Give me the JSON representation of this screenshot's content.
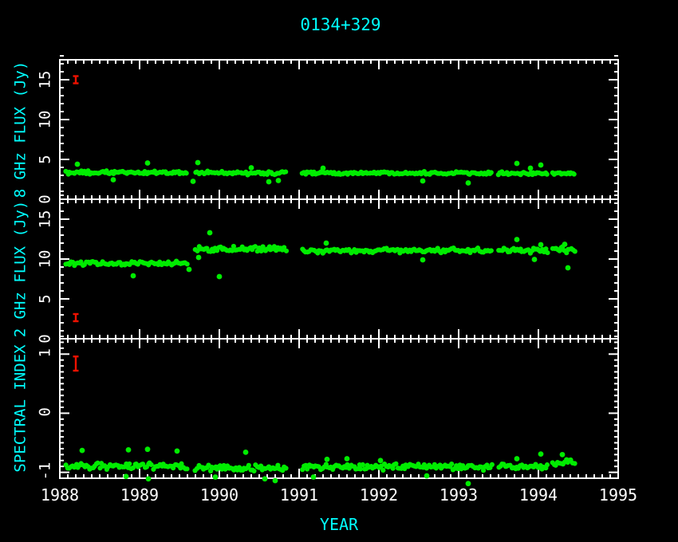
{
  "title": "0134+329",
  "xlabel": "YEAR",
  "colors": {
    "background": "#000000",
    "axis": "#ffffff",
    "tick_text": "#ffffff",
    "label": "#00ffff",
    "data": "#00ec00",
    "error": "#ee1100"
  },
  "x_axis": {
    "range": [
      1988,
      1995
    ],
    "tick_values": [
      1988,
      1989,
      1990,
      1991,
      1992,
      1993,
      1994,
      1995
    ],
    "tick_labels": [
      "1988",
      "1989",
      "1990",
      "1991",
      "1992",
      "1993",
      "1994",
      "1995"
    ],
    "minor_step": 0.1
  },
  "chart_data": [
    {
      "type": "scatter",
      "name": "8 GHz flux vs year",
      "ylabel": "8 GHz FLUX (Jy)",
      "ylim": [
        0,
        17.5
      ],
      "ytick_values": [
        0,
        5,
        10,
        15
      ],
      "ytick_labels": [
        "0",
        "5",
        "10",
        "15"
      ],
      "y_minor_step": 1,
      "bands": [
        {
          "from": 1988.08,
          "to": 1989.6,
          "level": 3.35,
          "scatter": 0.18
        },
        {
          "from": 1989.7,
          "to": 1990.84,
          "level": 3.3,
          "scatter": 0.2
        },
        {
          "from": 1991.04,
          "to": 1993.42,
          "level": 3.3,
          "scatter": 0.15
        },
        {
          "from": 1993.5,
          "to": 1994.1,
          "level": 3.25,
          "scatter": 0.15
        },
        {
          "from": 1994.18,
          "to": 1994.45,
          "level": 3.2,
          "scatter": 0.12
        }
      ],
      "outlier_points": [
        [
          1988.22,
          4.4
        ],
        [
          1989.1,
          4.55
        ],
        [
          1989.73,
          4.6
        ],
        [
          1988.67,
          2.45
        ],
        [
          1989.67,
          2.25
        ],
        [
          1990.4,
          3.95
        ],
        [
          1990.62,
          2.2
        ],
        [
          1990.74,
          2.35
        ],
        [
          1991.3,
          3.9
        ],
        [
          1992.55,
          2.3
        ],
        [
          1993.12,
          2.05
        ],
        [
          1993.73,
          4.5
        ],
        [
          1993.9,
          3.9
        ],
        [
          1994.03,
          4.3
        ]
      ],
      "error_bar": {
        "x": 1988.2,
        "y": 15.0,
        "err": 0.45
      }
    },
    {
      "type": "scatter",
      "name": "2 GHz flux vs year",
      "ylabel": "2 GHz FLUX (Jy)",
      "ylim": [
        0,
        17.5
      ],
      "ytick_values": [
        0,
        5,
        10,
        15
      ],
      "ytick_labels": [
        "0",
        "5",
        "10",
        "15"
      ],
      "y_minor_step": 1,
      "bands": [
        {
          "from": 1988.08,
          "to": 1989.6,
          "level": 9.45,
          "scatter": 0.25
        },
        {
          "from": 1989.7,
          "to": 1990.84,
          "level": 11.25,
          "scatter": 0.3
        },
        {
          "from": 1991.04,
          "to": 1993.42,
          "level": 11.05,
          "scatter": 0.25
        },
        {
          "from": 1993.5,
          "to": 1994.1,
          "level": 11.05,
          "scatter": 0.28
        },
        {
          "from": 1994.18,
          "to": 1994.45,
          "level": 11.15,
          "scatter": 0.35
        }
      ],
      "outlier_points": [
        [
          1988.92,
          7.9
        ],
        [
          1989.62,
          8.7
        ],
        [
          1989.74,
          10.2
        ],
        [
          1989.88,
          13.3
        ],
        [
          1990.0,
          7.8
        ],
        [
          1991.34,
          12.0
        ],
        [
          1992.55,
          9.9
        ],
        [
          1993.73,
          12.45
        ],
        [
          1993.95,
          9.95
        ],
        [
          1994.03,
          11.8
        ],
        [
          1994.33,
          11.85
        ],
        [
          1994.37,
          8.9
        ]
      ],
      "error_bar": {
        "x": 1988.2,
        "y": 2.65,
        "err": 0.45
      }
    },
    {
      "type": "scatter",
      "name": "spectral index vs year",
      "ylabel": "SPECTRAL INDEX",
      "ylim": [
        -1.12,
        1.24
      ],
      "ytick_values": [
        -1,
        0,
        1
      ],
      "ytick_labels": [
        "-1",
        "0",
        "1"
      ],
      "y_minor_step": 0.1,
      "bands": [
        {
          "from": 1988.08,
          "to": 1989.6,
          "level": -0.92,
          "scatter": 0.05
        },
        {
          "from": 1989.7,
          "to": 1990.84,
          "level": -0.95,
          "scatter": 0.05
        },
        {
          "from": 1991.04,
          "to": 1993.42,
          "level": -0.93,
          "scatter": 0.045
        },
        {
          "from": 1993.5,
          "to": 1994.1,
          "level": -0.92,
          "scatter": 0.045
        },
        {
          "from": 1994.18,
          "to": 1994.45,
          "level": -0.86,
          "scatter": 0.05
        }
      ],
      "outlier_points": [
        [
          1988.28,
          -0.65
        ],
        [
          1988.83,
          -1.09
        ],
        [
          1988.86,
          -0.64
        ],
        [
          1989.1,
          -0.63
        ],
        [
          1989.11,
          -1.13
        ],
        [
          1989.47,
          -0.66
        ],
        [
          1989.95,
          -1.1
        ],
        [
          1990.33,
          -0.68
        ],
        [
          1990.57,
          -1.13
        ],
        [
          1990.7,
          -1.16
        ],
        [
          1991.18,
          -1.1
        ],
        [
          1991.35,
          -0.8
        ],
        [
          1991.6,
          -0.79
        ],
        [
          1992.02,
          -0.82
        ],
        [
          1992.6,
          -1.08
        ],
        [
          1993.12,
          -1.21
        ],
        [
          1993.73,
          -0.79
        ],
        [
          1994.03,
          -0.71
        ],
        [
          1994.3,
          -0.72
        ]
      ],
      "error_bar": {
        "x": 1988.2,
        "y": 0.82,
        "err": 0.12
      }
    }
  ]
}
